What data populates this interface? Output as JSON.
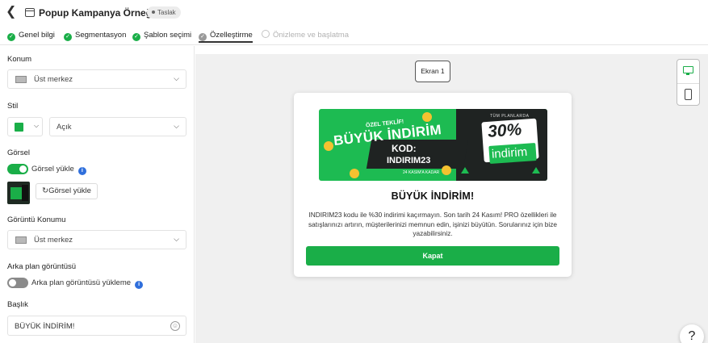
{
  "header": {
    "back_icon": "chevron-left-icon",
    "window_icon": "window-icon",
    "title": "Popup Kampanya Örneği",
    "status_badge": "Taslak"
  },
  "steps": [
    {
      "label": "Genel bilgi",
      "state": "done"
    },
    {
      "label": "Segmentasyon",
      "state": "done"
    },
    {
      "label": "Şablon seçimi",
      "state": "done"
    },
    {
      "label": "Özelleştirme",
      "state": "current"
    },
    {
      "label": "Önizleme ve başlatma",
      "state": "disabled"
    }
  ],
  "panel": {
    "konum_label": "Konum",
    "konum_value": "Üst merkez",
    "stil_label": "Stil",
    "stil_color": "#1aae48",
    "stil_value": "Açık",
    "gorsel_label": "Görsel",
    "gorsel_toggle_label": "Görsel yükle",
    "gorsel_toggle_on": true,
    "upload_button": "Görsel yükle",
    "goruntu_konumu_label": "Görüntü Konumu",
    "goruntu_konumu_value": "Üst merkez",
    "arka_plan_label": "Arka plan görüntüsü",
    "arka_plan_toggle_label": "Arka plan görüntüsü yükleme",
    "arka_plan_toggle_on": false,
    "baslik_label": "Başlık",
    "baslik_value": "BÜYÜK İNDİRİM!"
  },
  "preview": {
    "screen_label": "Ekran 1",
    "device_icons": [
      "desktop-icon",
      "mobile-icon"
    ],
    "banner": {
      "special": "ÖZEL TEKLİF!",
      "big": "BÜYÜK İNDİRİM",
      "kod": "KOD:",
      "code": "INDIRIM23",
      "small": "24 KASIM'A KADAR",
      "plans": "TÜM PLANLARDA",
      "percent": "30%",
      "word": "indirim"
    },
    "title": "BÜYÜK İNDİRİM!",
    "body": "INDIRIM23 kodu ile %30 indirimi kaçırmayın. Son tarih 24 Kasım! PRO özellikleri ile satışlarınızı artırın, müşterilerinizi memnun edin, işinizi büyütün. Sorularınız için bize yazabilirsiniz.",
    "button": "Kapat"
  },
  "help_label": "?",
  "colors": {
    "accent": "#1aae48",
    "dark": "#1f2322",
    "info": "#2f6fdc"
  }
}
